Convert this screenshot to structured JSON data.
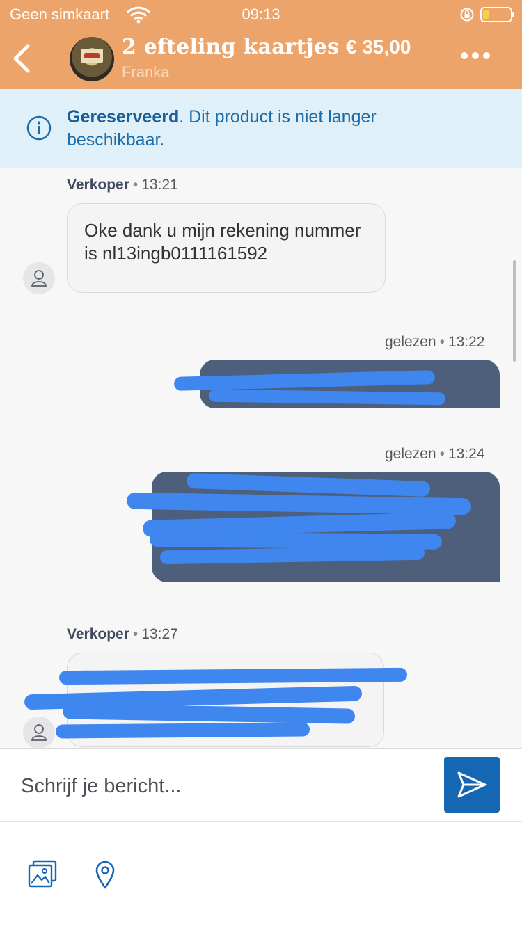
{
  "status_bar": {
    "carrier": "Geen simkaart",
    "time": "09:13"
  },
  "header": {
    "listing_title": "2 efteling kaartjes",
    "price": "€ 35,00",
    "seller": "Franka"
  },
  "banner": {
    "status_bold": "Gereserveerd",
    "status_text": ". Dit product is niet langer beschikbaar."
  },
  "messages": [
    {
      "direction": "incoming",
      "sender": "Verkoper",
      "time": "13:21",
      "text": "Oke dank u mijn rekening nummer is nl13ingb0111161592"
    },
    {
      "direction": "outgoing",
      "status": "gelezen",
      "time": "13:22",
      "text_redacted": true
    },
    {
      "direction": "outgoing",
      "status": "gelezen",
      "time": "13:24",
      "text_redacted": true
    },
    {
      "direction": "incoming",
      "sender": "Verkoper",
      "time": "13:27",
      "text_redacted": true
    }
  ],
  "composer": {
    "placeholder": "Schrijf je bericht..."
  },
  "icons": {
    "back": "chevron-left-icon",
    "more": "more-horizontal-icon",
    "info": "info-icon",
    "send": "send-icon",
    "photo": "image-gallery-icon",
    "location": "location-pin-icon"
  },
  "colors": {
    "header_bg": "#eda46a",
    "banner_bg": "#dff0f8",
    "banner_text": "#1a6cab",
    "outgoing_bubble": "#4d5f7a",
    "send_button": "#1567b3",
    "redaction": "#3f86ef"
  }
}
